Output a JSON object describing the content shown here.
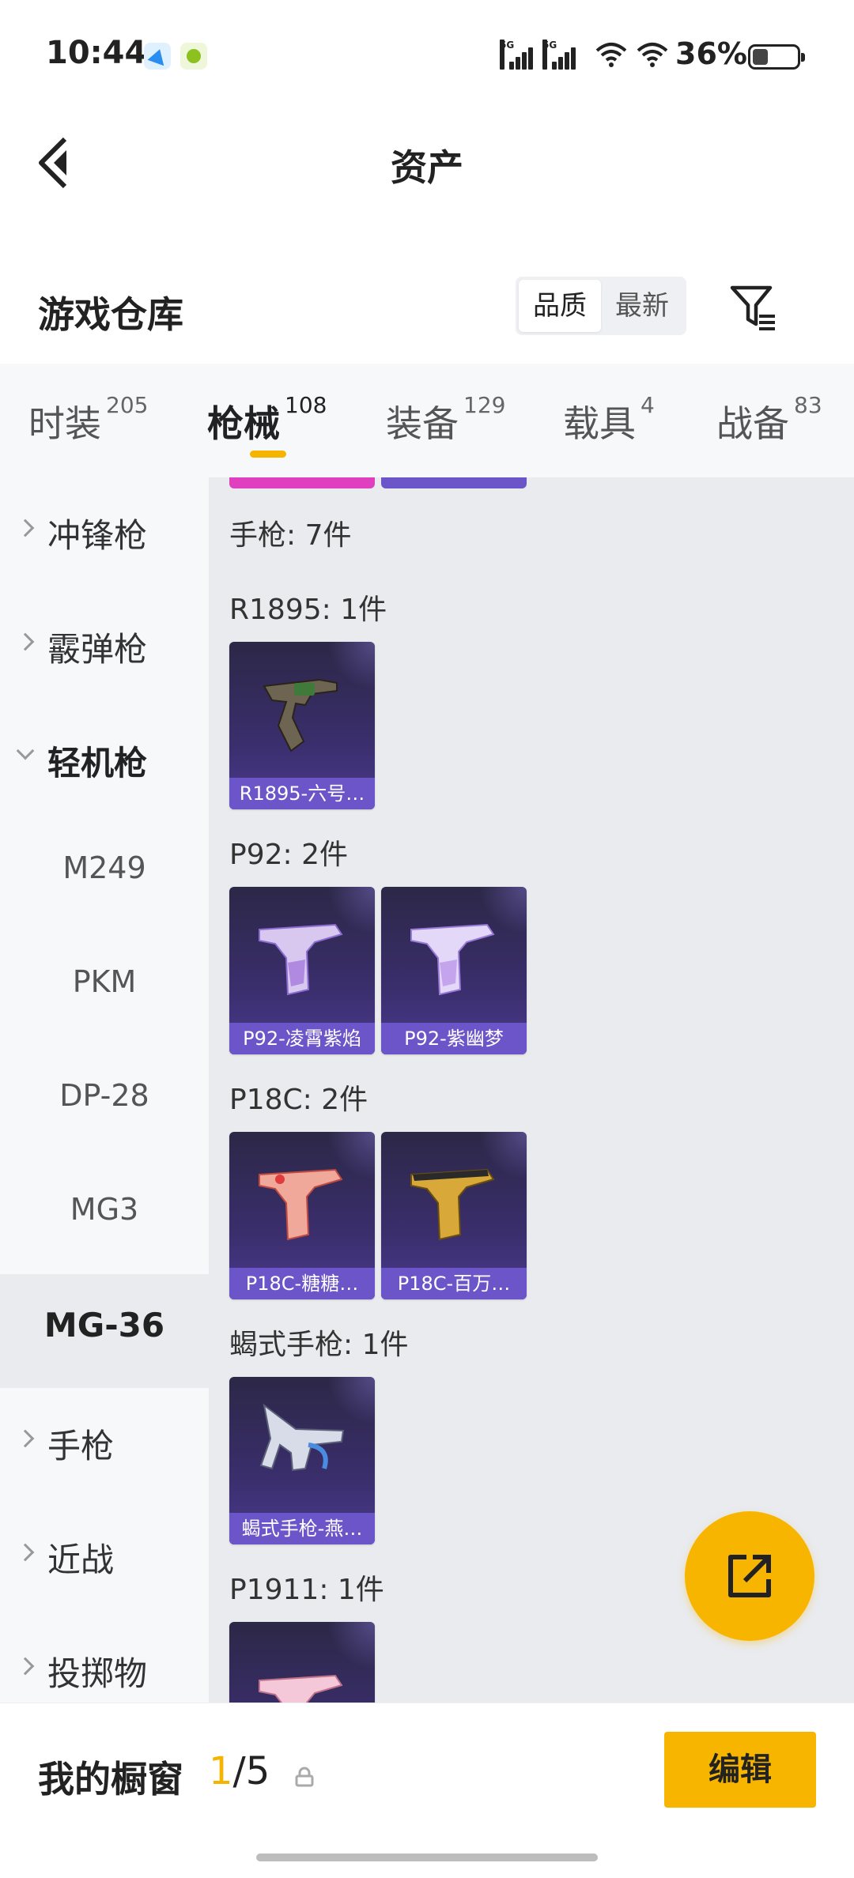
{
  "status_bar": {
    "time": "10:44",
    "battery": "36%",
    "battery_fraction": 0.36,
    "signal1_label": "5G",
    "signal2_label": "5G"
  },
  "header": {
    "title": "资产",
    "back_icon": "chevron-left-icon"
  },
  "subheader": {
    "title": "游戏仓库",
    "sort_options": [
      "品质",
      "最新"
    ],
    "filter_icon": "filter-icon"
  },
  "tabs": [
    {
      "label": "时装",
      "count": "205"
    },
    {
      "label": "枪械",
      "count": "108"
    },
    {
      "label": "装备",
      "count": "129"
    },
    {
      "label": "载具",
      "count": "4"
    },
    {
      "label": "战备",
      "count": "83"
    }
  ],
  "sidebar": {
    "items": [
      {
        "label": "冲锋枪"
      },
      {
        "label": "霰弹枪"
      },
      {
        "label": "轻机枪"
      },
      {
        "label": "M249"
      },
      {
        "label": "PKM"
      },
      {
        "label": "DP-28"
      },
      {
        "label": "MG3"
      },
      {
        "label": "MG-36"
      },
      {
        "label": "手枪"
      },
      {
        "label": "近战"
      },
      {
        "label": "投掷物"
      }
    ]
  },
  "content": {
    "section_title": "手枪: 7件",
    "groups": [
      {
        "title": "R1895: 1件",
        "cards": [
          {
            "name": "R1895-六号…"
          }
        ]
      },
      {
        "title": "P92: 2件",
        "cards": [
          {
            "name": "P92-凌霄紫焰"
          },
          {
            "name": "P92-紫幽梦"
          }
        ]
      },
      {
        "title": "P18C: 2件",
        "cards": [
          {
            "name": "P18C-糖糖…"
          },
          {
            "name": "P18C-百万…"
          }
        ]
      },
      {
        "title": "蝎式手枪: 1件",
        "cards": [
          {
            "name": "蝎式手枪-燕…"
          }
        ]
      },
      {
        "title": "P1911: 1件",
        "cards": [
          {
            "name": ""
          }
        ]
      }
    ]
  },
  "fab": {
    "icon": "share-external-icon"
  },
  "bottom_bar": {
    "label": "我的橱窗",
    "current": "1",
    "total": "/5",
    "lock_icon": "lock-icon",
    "edit_label": "编辑"
  },
  "colors": {
    "accent": "#f8b500",
    "card_label_bg": "#6c55c8",
    "card_bg": "#3a2e6c"
  }
}
